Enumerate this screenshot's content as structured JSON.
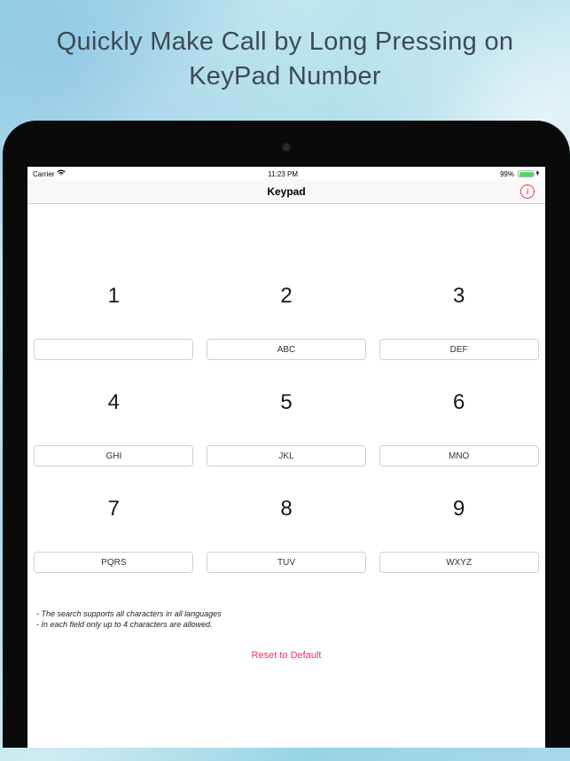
{
  "promo": {
    "text": "Quickly Make Call by Long Pressing on KeyPad Number"
  },
  "status": {
    "carrier": "Carrier",
    "time": "11:23 PM",
    "battery_percent": "99%"
  },
  "nav": {
    "title": "Keypad"
  },
  "keys": [
    {
      "digit": "1",
      "letters": ""
    },
    {
      "digit": "2",
      "letters": "ABC"
    },
    {
      "digit": "3",
      "letters": "DEF"
    },
    {
      "digit": "4",
      "letters": "GHI"
    },
    {
      "digit": "5",
      "letters": "JKL"
    },
    {
      "digit": "6",
      "letters": "MNO"
    },
    {
      "digit": "7",
      "letters": "PQRS"
    },
    {
      "digit": "8",
      "letters": "TUV"
    },
    {
      "digit": "9",
      "letters": "WXYZ"
    }
  ],
  "footnotes": [
    "- The search supports all characters in all languages",
    "- In each field only up to 4 characters are allowed."
  ],
  "reset_label": "Reset to Default"
}
